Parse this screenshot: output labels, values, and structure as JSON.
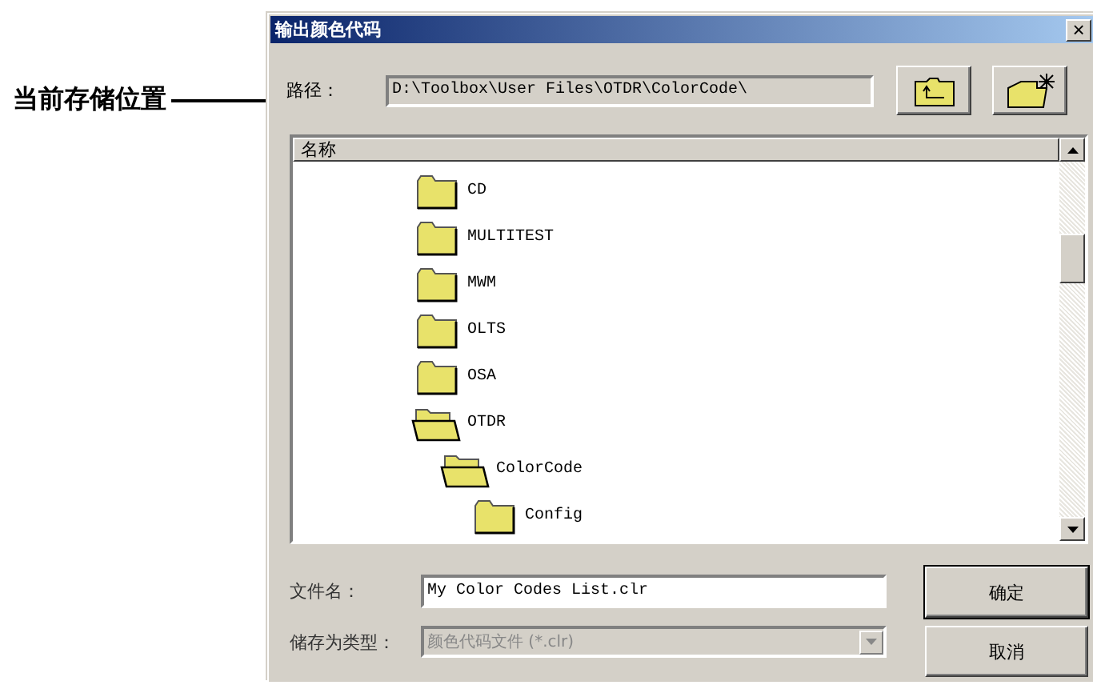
{
  "annotation": {
    "label": "当前存储位置"
  },
  "window": {
    "title": "输出颜色代码",
    "close": "×"
  },
  "path": {
    "label": "路径：",
    "value": "D:\\Toolbox\\User Files\\OTDR\\ColorCode\\"
  },
  "list": {
    "column": "名称",
    "tree": [
      {
        "name": "CD",
        "expanded": false
      },
      {
        "name": "MULTITEST",
        "expanded": false
      },
      {
        "name": "MWM",
        "expanded": false
      },
      {
        "name": "OLTS",
        "expanded": false
      },
      {
        "name": "OSA",
        "expanded": false
      },
      {
        "name": "OTDR",
        "expanded": true,
        "children": [
          {
            "name": "ColorCode",
            "expanded": true,
            "children": [
              {
                "name": "Config",
                "expanded": false
              }
            ]
          }
        ]
      }
    ]
  },
  "file_name": {
    "label": "文件名：",
    "value": "My Color Codes List.clr"
  },
  "file_type": {
    "label": "储存为类型：",
    "value": "颜色代码文件 (*.clr)",
    "disabled": true
  },
  "buttons": [
    {
      "label": "确定",
      "default": true
    },
    {
      "label": "取消",
      "default": false
    }
  ]
}
